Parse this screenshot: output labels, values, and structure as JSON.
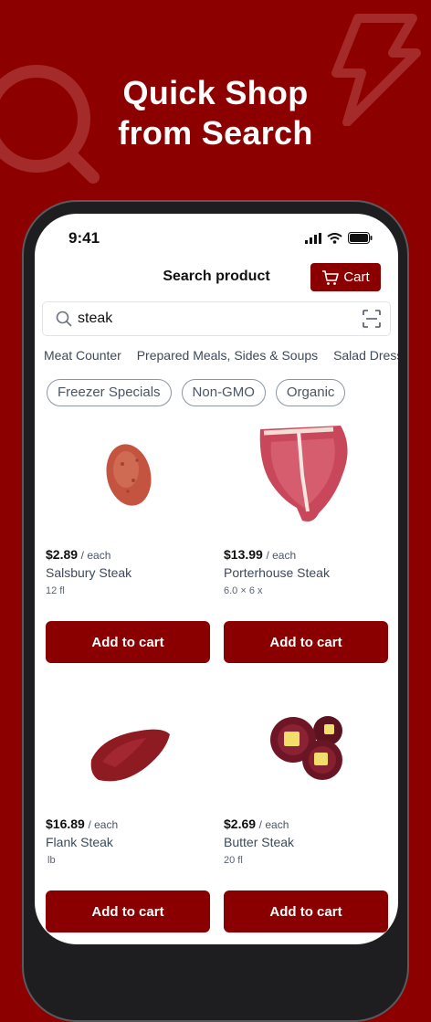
{
  "promo": {
    "headline_line1": "Quick Shop",
    "headline_line2": "from Search"
  },
  "status_bar": {
    "time": "9:41"
  },
  "header": {
    "title": "Search product",
    "cart_label": "Cart"
  },
  "search": {
    "query": "steak"
  },
  "categories": [
    "Meat Counter",
    "Prepared Meals, Sides & Soups",
    "Salad Dress"
  ],
  "filters": [
    "Freezer Specials",
    "Non-GMO",
    "Organic"
  ],
  "products": [
    {
      "price": "$2.89",
      "unit": "/ each",
      "name": "Salsbury Steak",
      "size": "12 fl",
      "button": "Add to cart"
    },
    {
      "price": "$13.99",
      "unit": "/ each",
      "name": "Porterhouse Steak",
      "size": "6.0 × 6 x",
      "button": "Add to cart"
    },
    {
      "price": "$16.89",
      "unit": "/ each",
      "name": "Flank Steak",
      "size": "lb",
      "button": "Add to cart"
    },
    {
      "price": "$2.69",
      "unit": "/ each",
      "name": "Butter Steak",
      "size": "20 fl",
      "button": "Add to cart"
    }
  ],
  "colors": {
    "brand": "#8a0000",
    "background": "#8c0000"
  }
}
